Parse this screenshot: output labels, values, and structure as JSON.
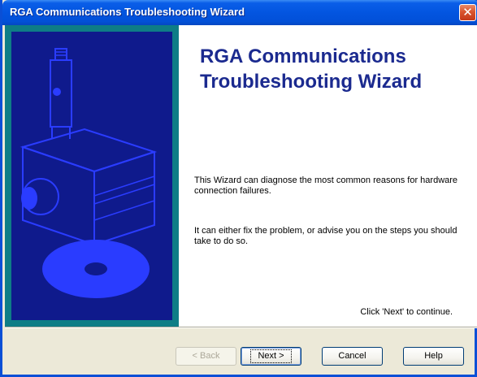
{
  "window": {
    "title": "RGA Communications Troubleshooting Wizard",
    "close_glyph": "✕"
  },
  "main": {
    "heading": "RGA Communications Troubleshooting Wizard",
    "paragraph1": "This Wizard can diagnose the most common reasons for hardware connection failures.",
    "paragraph2": "It can either fix the problem, or advise you on the steps you should take to do so.",
    "continue_hint": "Click 'Next' to continue."
  },
  "buttons": {
    "back": "< Back",
    "next": "Next >",
    "cancel": "Cancel",
    "help": "Help"
  },
  "colors": {
    "title_bar": "#0355e0",
    "side_panel": "#0f1a8c",
    "side_border": "#0e7d86",
    "heading": "#1b2a8f"
  },
  "side_panel": {
    "illustration": "rga-device-illustration"
  }
}
